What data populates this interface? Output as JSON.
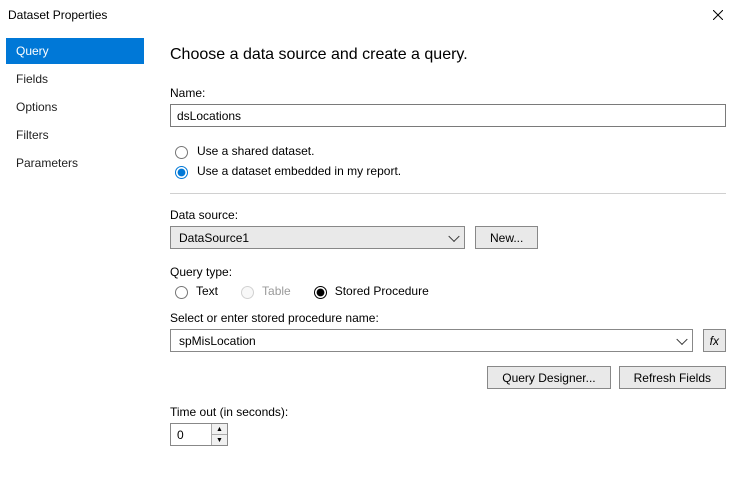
{
  "window": {
    "title": "Dataset Properties"
  },
  "sidebar": {
    "items": [
      {
        "label": "Query"
      },
      {
        "label": "Fields"
      },
      {
        "label": "Options"
      },
      {
        "label": "Filters"
      },
      {
        "label": "Parameters"
      }
    ],
    "selected": 0
  },
  "main": {
    "heading": "Choose a data source and create a query.",
    "name_label": "Name:",
    "name_value": "dsLocations",
    "radio_shared": "Use a shared dataset.",
    "radio_embedded": "Use a dataset embedded in my report.",
    "datasource_label": "Data source:",
    "datasource_value": "DataSource1",
    "new_button": "New...",
    "querytype_label": "Query type:",
    "qt_text": "Text",
    "qt_table": "Table",
    "qt_sp": "Stored Procedure",
    "sp_label": "Select or enter stored procedure name:",
    "sp_value": "spMisLocation",
    "fx_button": "fx",
    "query_designer_button": "Query Designer...",
    "refresh_fields_button": "Refresh Fields",
    "timeout_label": "Time out (in seconds):",
    "timeout_value": "0"
  }
}
